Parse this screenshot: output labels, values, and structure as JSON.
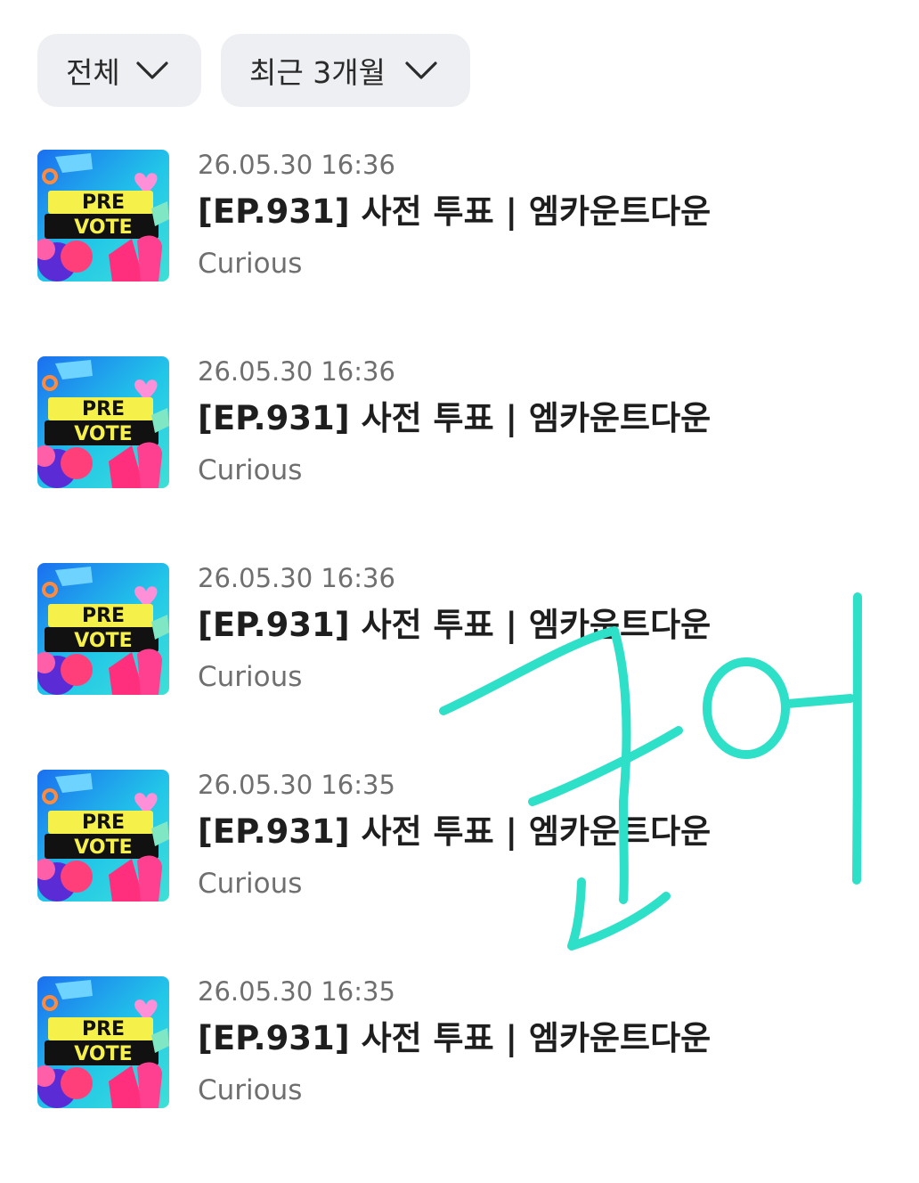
{
  "filters": {
    "category": "전체",
    "period": "최근 3개월"
  },
  "items": [
    {
      "date": "26.05.30 16:36",
      "title": "[EP.931] 사전 투표 | 엠카운트다운",
      "artist": "Curious",
      "thumb_text_top": "PRE",
      "thumb_text_bottom": "VOTE"
    },
    {
      "date": "26.05.30 16:36",
      "title": "[EP.931] 사전 투표 | 엠카운트다운",
      "artist": "Curious",
      "thumb_text_top": "PRE",
      "thumb_text_bottom": "VOTE"
    },
    {
      "date": "26.05.30 16:36",
      "title": "[EP.931] 사전 투표 | 엠카운트다운",
      "artist": "Curious",
      "thumb_text_top": "PRE",
      "thumb_text_bottom": "VOTE"
    },
    {
      "date": "26.05.30 16:35",
      "title": "[EP.931] 사전 투표 | 엠카운트다운",
      "artist": "Curious",
      "thumb_text_top": "PRE",
      "thumb_text_bottom": "VOTE"
    },
    {
      "date": "26.05.30 16:35",
      "title": "[EP.931] 사전 투표 | 엠카운트다운",
      "artist": "Curious",
      "thumb_text_top": "PRE",
      "thumb_text_bottom": "VOTE"
    }
  ],
  "handwriting": {
    "text": "고여",
    "color": "#2ee0c8"
  },
  "icons": {
    "dropdown": "chevron-down-icon"
  }
}
